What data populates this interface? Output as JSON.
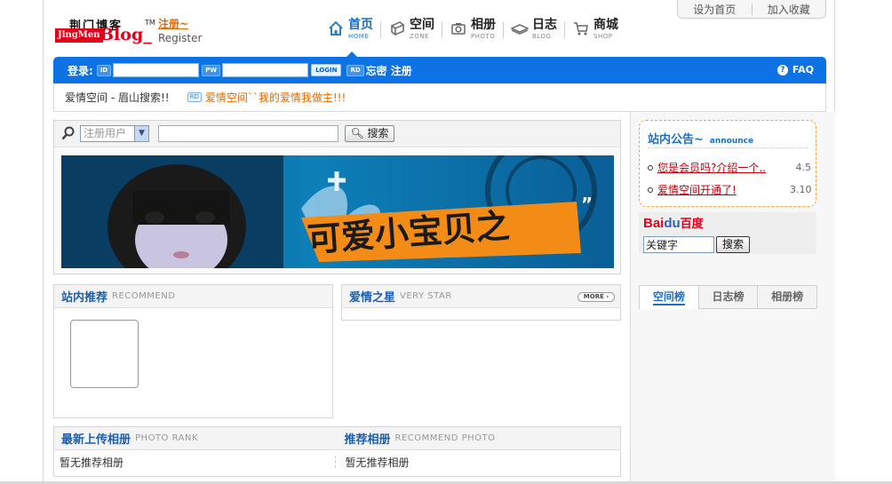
{
  "toplinks": {
    "homepage": "设为首页",
    "favorite": "加入收藏"
  },
  "logo": {
    "cn_name": "荆门博客",
    "tm": "TM",
    "register_cn": "注册~",
    "jingmen": "JingMen",
    "blog": "Blog",
    "register_en": "Register"
  },
  "nav": [
    {
      "cn": "首页",
      "en": "HOME",
      "icon": "home-icon",
      "active": true
    },
    {
      "cn": "空间",
      "en": "ZONE",
      "icon": "zone-icon",
      "active": false
    },
    {
      "cn": "相册",
      "en": "PHOTO",
      "icon": "camera-icon",
      "active": false
    },
    {
      "cn": "日志",
      "en": "BLOG",
      "icon": "book-icon",
      "active": false
    },
    {
      "cn": "商城",
      "en": "SHOP",
      "icon": "cart-icon",
      "active": false
    }
  ],
  "login": {
    "label": "登录:",
    "id_tag": "ID",
    "pw_tag": "PW",
    "login_btn": "LOGIN",
    "forgot_tag": "RD",
    "forgot": "忘密",
    "register": "注册",
    "faq": "FAQ"
  },
  "notice": {
    "text": "爱情空间 - 眉山搜索!!",
    "tag": "RD",
    "link": "爱情空间``我的爱情我做主!!!"
  },
  "search": {
    "select_value": "注册用户",
    "button": "搜索"
  },
  "banner": {
    "text": "可爱小宝贝之"
  },
  "recommend": {
    "title": "站内推荐",
    "subtitle": "RECOMMEND"
  },
  "star": {
    "title": "爱情之星",
    "subtitle": "VERY STAR",
    "more": "MORE"
  },
  "latest_photos": {
    "title": "最新上传相册",
    "subtitle": "PHOTO RANK",
    "empty": "暂无推荐相册"
  },
  "recommend_photos": {
    "title": "推荐相册",
    "subtitle": "RECOMMEND PHOTO",
    "empty": "暂无推荐相册"
  },
  "announce": {
    "title": "站内公告",
    "tilde": "~",
    "subtitle": "announce",
    "items": [
      {
        "text": "您是会员吗?介绍一个..",
        "date": "4.5"
      },
      {
        "text": "爱情空间开通了!",
        "date": "3.10"
      }
    ]
  },
  "baidu": {
    "logo_a": "Bai",
    "logo_b": "du",
    "logo_cn": "百度",
    "input_value": "关键字",
    "button": "搜索"
  },
  "rank_tabs": [
    {
      "label": "空间榜",
      "active": true
    },
    {
      "label": "日志榜",
      "active": false
    },
    {
      "label": "相册榜",
      "active": false
    }
  ],
  "colors": {
    "accent_blue": "#0d73e4",
    "brand_red": "#e3001b",
    "link_orange": "#e06b00",
    "announce_border": "#f3a43c"
  }
}
